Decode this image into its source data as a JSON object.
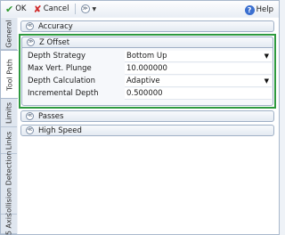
{
  "toolbar": {
    "ok_label": "OK",
    "cancel_label": "Cancel",
    "expand_glyph": "≫",
    "help_label": "Help"
  },
  "tabs": [
    {
      "label": "General"
    },
    {
      "label": "Tool Path"
    },
    {
      "label": "Limits"
    },
    {
      "label": "Links"
    },
    {
      "label": "Collision Detection"
    },
    {
      "label": "5 Axis"
    }
  ],
  "sections": {
    "accuracy": {
      "title": "Accuracy"
    },
    "z_offset": {
      "title": "Z Offset",
      "rows": [
        {
          "label": "Depth Strategy",
          "value": "Bottom Up",
          "dropdown": true
        },
        {
          "label": "Max Vert. Plunge",
          "value": "10.000000",
          "dropdown": false
        },
        {
          "label": "Depth Calculation",
          "value": "Adaptive",
          "dropdown": true
        },
        {
          "label": "Incremental Depth",
          "value": "0.500000",
          "dropdown": false
        }
      ]
    },
    "passes": {
      "title": "Passes"
    },
    "high_speed": {
      "title": "High Speed"
    }
  },
  "icons": {
    "ok": "check-icon",
    "cancel": "x-icon",
    "help": "help-icon",
    "collapse": "double-chevron-icon"
  },
  "colors": {
    "highlight_border": "#2e9a3f",
    "ok_icon": "#2f9a2f",
    "cancel_icon": "#d02a2a",
    "help_icon": "#3b6fd0"
  }
}
